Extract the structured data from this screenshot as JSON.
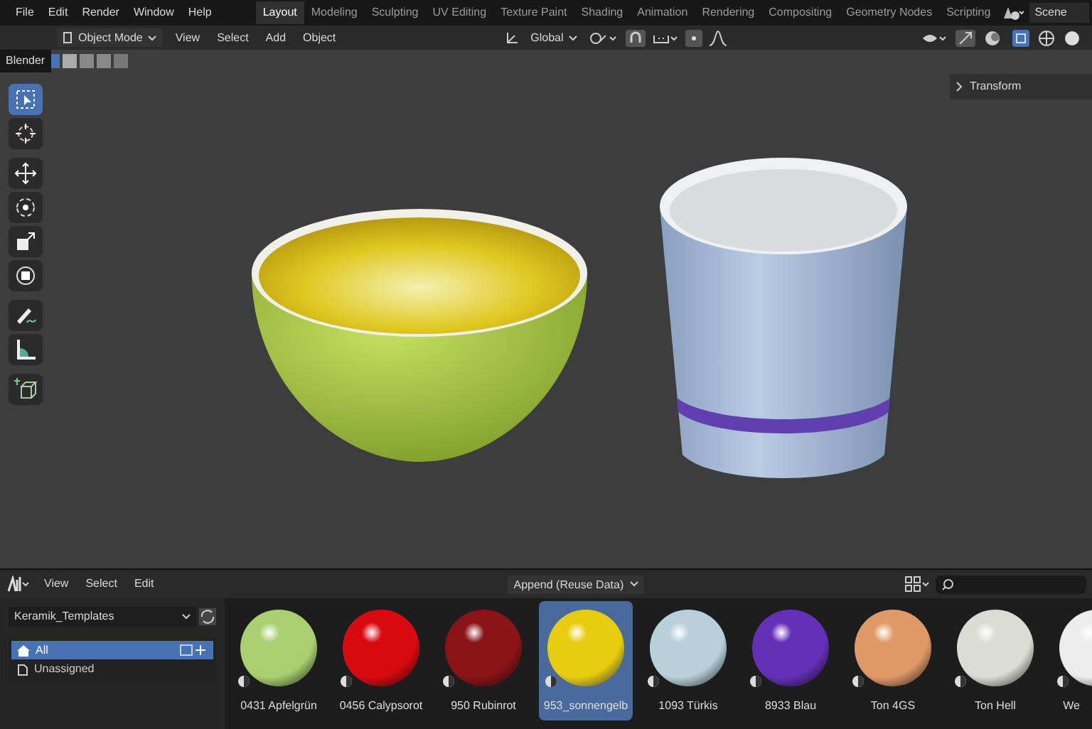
{
  "menu": [
    "File",
    "Edit",
    "Render",
    "Window",
    "Help"
  ],
  "workspaces": [
    {
      "label": "Layout",
      "selected": true
    },
    {
      "label": "Modeling",
      "selected": false
    },
    {
      "label": "Sculpting",
      "selected": false
    },
    {
      "label": "UV Editing",
      "selected": false
    },
    {
      "label": "Texture Paint",
      "selected": false
    },
    {
      "label": "Shading",
      "selected": false
    },
    {
      "label": "Animation",
      "selected": false
    },
    {
      "label": "Rendering",
      "selected": false
    },
    {
      "label": "Compositing",
      "selected": false
    },
    {
      "label": "Geometry Nodes",
      "selected": false
    },
    {
      "label": "Scripting",
      "selected": false
    }
  ],
  "scene": "Scene",
  "viewport_header": {
    "mode": "Object Mode",
    "menus": [
      "View",
      "Select",
      "Add",
      "Object"
    ],
    "orientation": "Global"
  },
  "tooltip": "Blender",
  "tools": [
    {
      "kind": "select",
      "selected": true
    },
    {
      "kind": "cursor",
      "selected": false
    },
    {
      "kind": "move",
      "selected": false
    },
    {
      "kind": "rotate",
      "selected": false
    },
    {
      "kind": "scale",
      "selected": false
    },
    {
      "kind": "transform",
      "selected": false
    },
    {
      "kind": "annotate",
      "selected": false
    },
    {
      "kind": "measure",
      "selected": false
    },
    {
      "kind": "add-cube",
      "selected": false
    }
  ],
  "sidebar_tab": "Transform",
  "asset_browser": {
    "menus": [
      "View",
      "Select",
      "Edit"
    ],
    "import_method": "Append (Reuse Data)",
    "library": "Keramik_Templates",
    "catalogs": [
      {
        "label": "All",
        "selected": true
      },
      {
        "label": "Unassigned",
        "selected": false
      }
    ],
    "assets": [
      {
        "name": "0431 Apfelgrün",
        "color": "#a8d070",
        "selected": false
      },
      {
        "name": "0456 Calypsorot",
        "color": "#d80a10",
        "selected": false
      },
      {
        "name": "950 Rubinrot",
        "color": "#8a1418",
        "selected": false
      },
      {
        "name": "953_sonnengelb",
        "color": "#e8cc10",
        "selected": true
      },
      {
        "name": "1093 Türkis",
        "color": "#b8d0dc",
        "selected": false
      },
      {
        "name": "8933 Blau",
        "color": "#6430b8",
        "selected": false
      },
      {
        "name": "Ton 4GS",
        "color": "#e09a68",
        "selected": false
      },
      {
        "name": "Ton Hell",
        "color": "#dcdcd6",
        "selected": false
      },
      {
        "name": "We",
        "color": "#ececec",
        "selected": false
      }
    ]
  }
}
